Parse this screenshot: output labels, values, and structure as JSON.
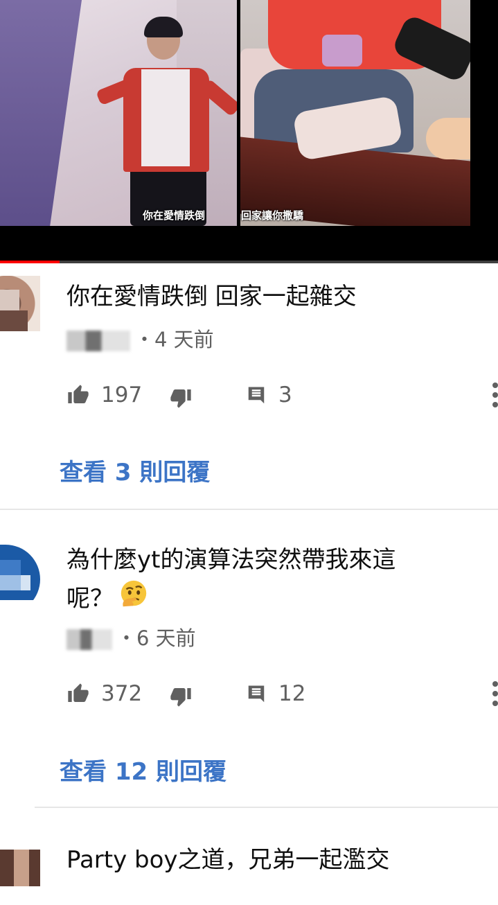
{
  "video": {
    "subtitle_left": "你在愛情跌倒",
    "subtitle_right": "回家讓你撒驕",
    "progress": 0.12
  },
  "comments": [
    {
      "text": "你在愛情跌倒 回家一起雜交",
      "author": "",
      "time": "・4 天前",
      "likes": "197",
      "reply_count": "3",
      "view_replies": "查看 3 則回覆"
    },
    {
      "text_line1": "為什麼yt的演算法突然帶我來這",
      "text_line2": "呢？",
      "emoji": "thinking-face-emoji",
      "author": "",
      "time": "・6 天前",
      "likes": "372",
      "reply_count": "12",
      "view_replies": "查看 12 則回覆"
    },
    {
      "text": "Party boy之道，兄弟一起濫交"
    }
  ],
  "icons": {
    "like": "thumbs-up-icon",
    "dislike": "thumbs-down-icon",
    "reply": "comment-icon",
    "more": "more-vertical-icon"
  },
  "colors": {
    "link": "#3c74c6",
    "progress": "#ff0000",
    "meta": "#606060"
  }
}
